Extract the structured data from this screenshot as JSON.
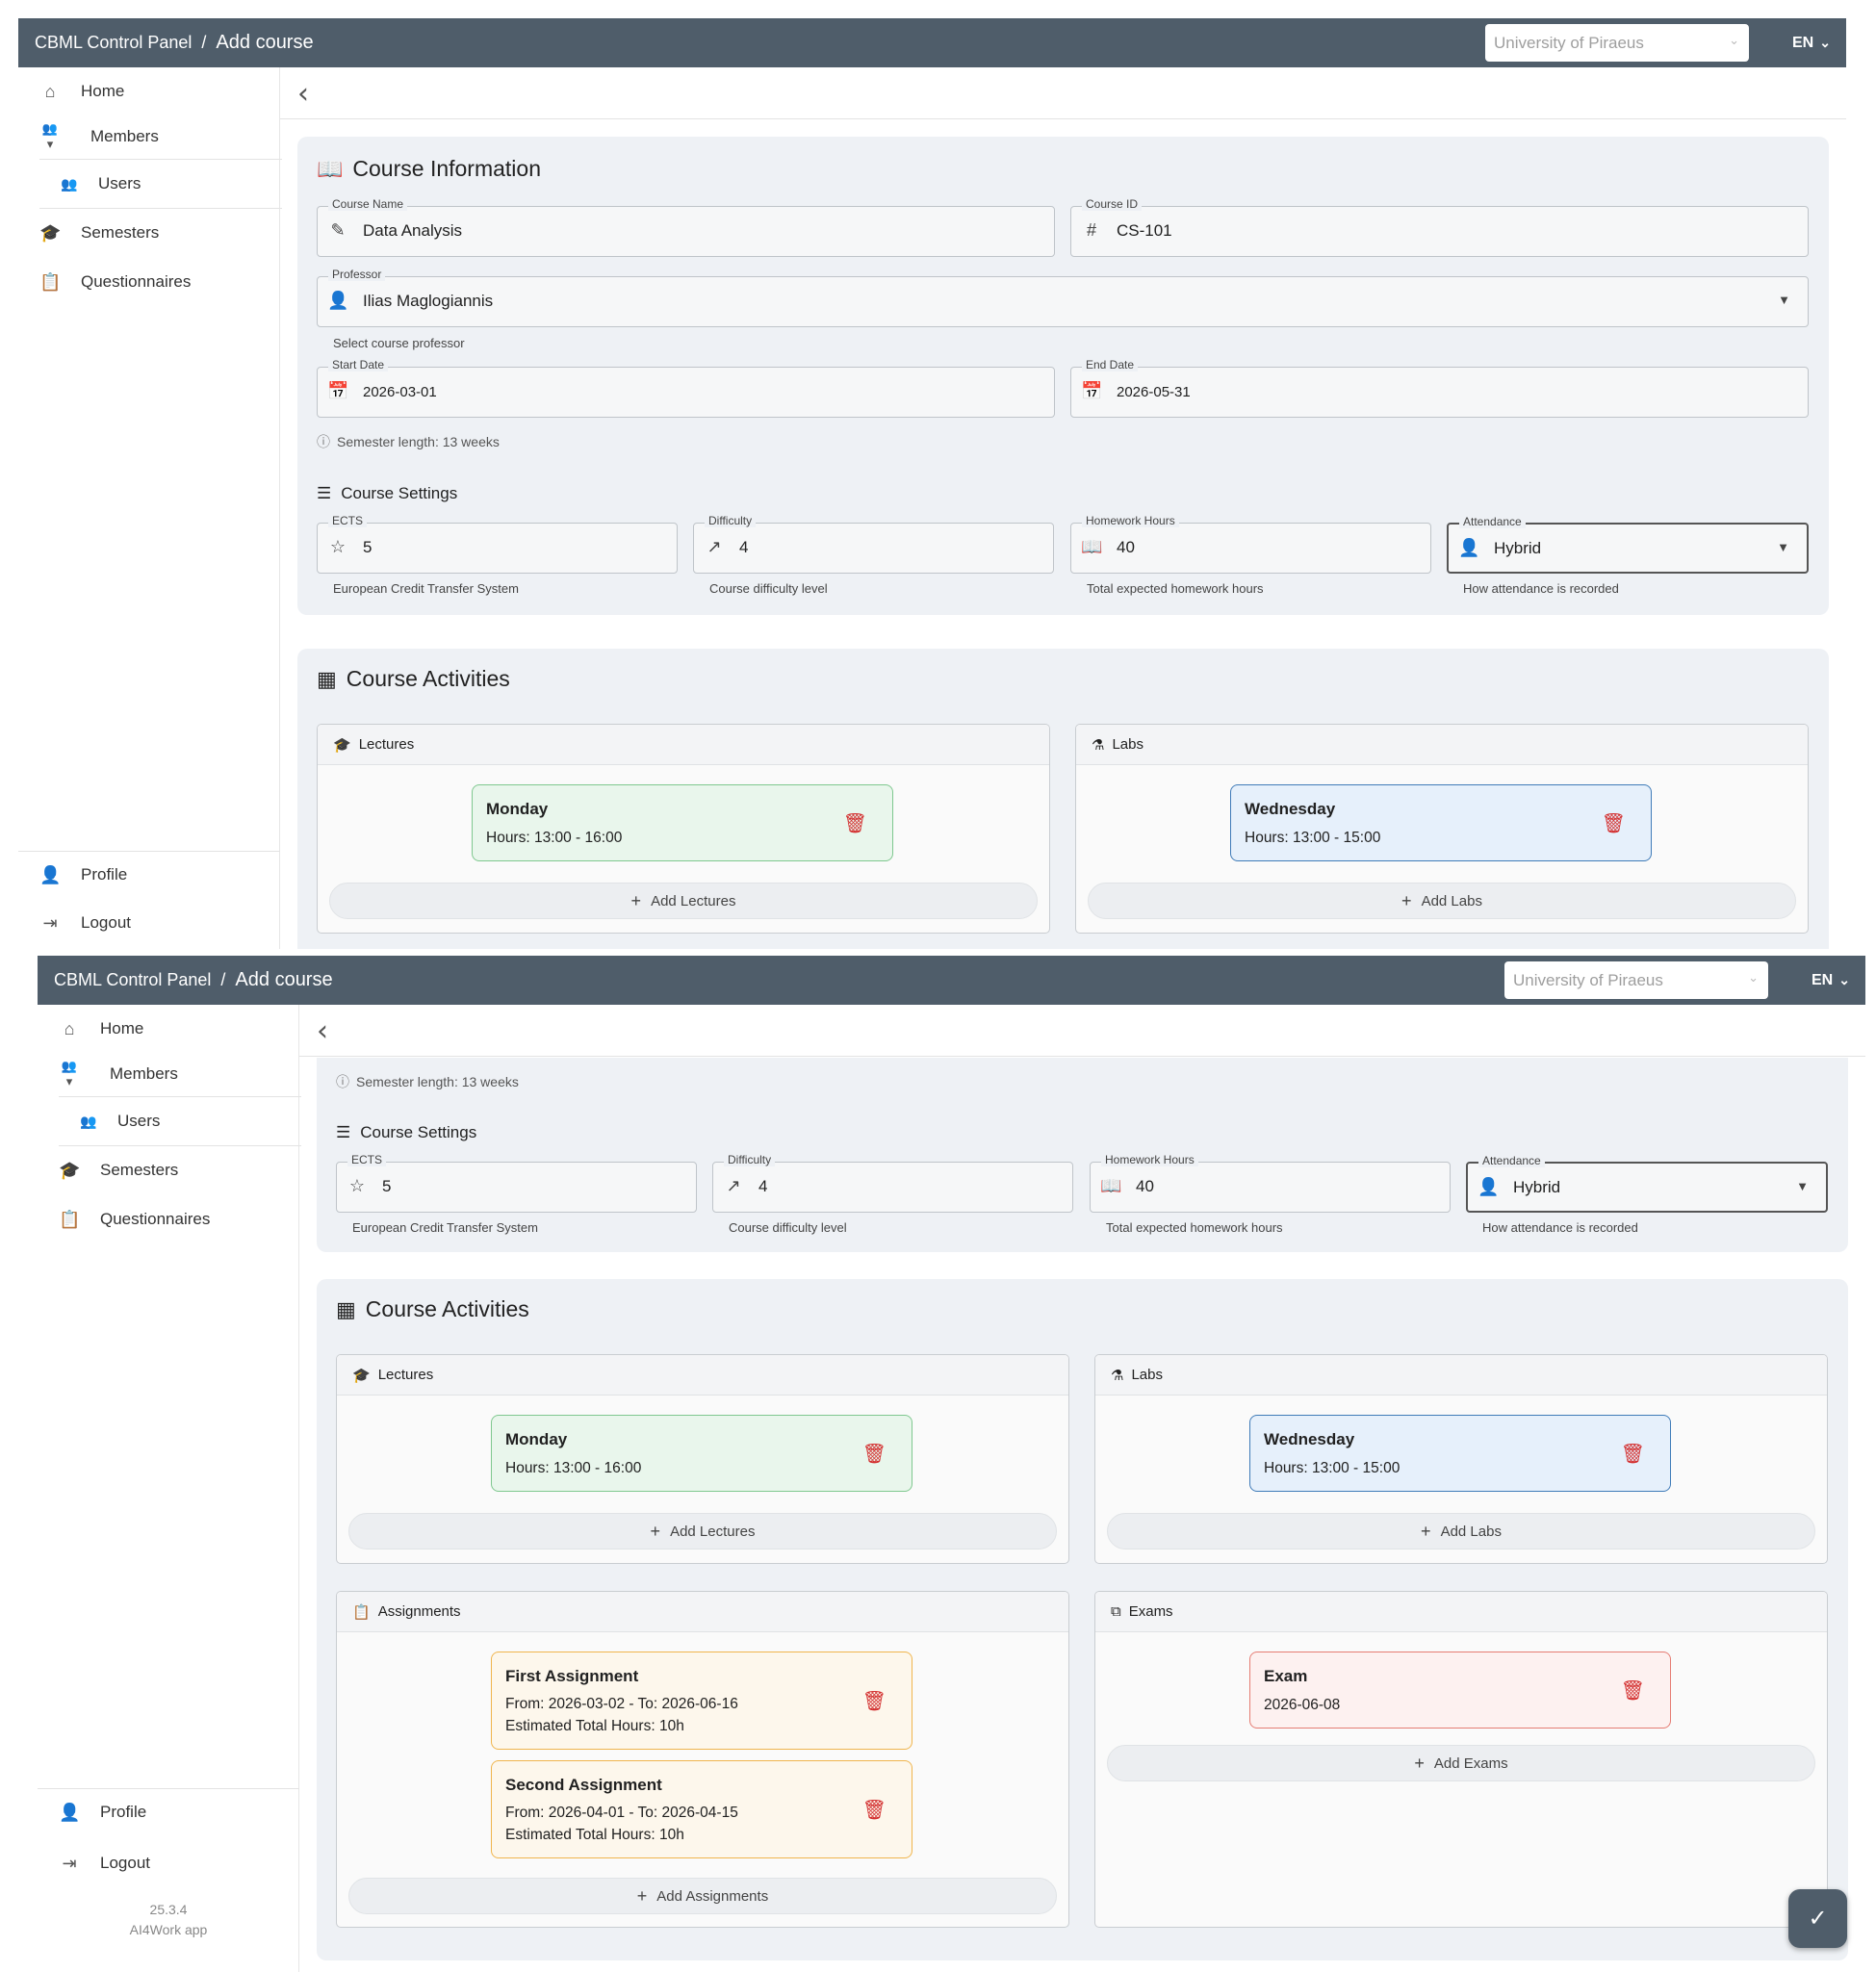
{
  "app": {
    "breadcrumb_root": "CBML Control Panel",
    "breadcrumb_sep": "/",
    "breadcrumb_current": "Add course",
    "university_placeholder": "University of Piraeus",
    "language": "EN"
  },
  "sidebar": {
    "home": "Home",
    "members": "Members",
    "users": "Users",
    "semesters": "Semesters",
    "questionnaires": "Questionnaires",
    "profile": "Profile",
    "logout": "Logout",
    "version": "25.3.4",
    "app_name": "AI4Work app"
  },
  "course_info": {
    "title": "Course Information",
    "course_name_label": "Course Name",
    "course_name": "Data Analysis",
    "course_id_label": "Course ID",
    "course_id": "CS-101",
    "professor_label": "Professor",
    "professor": "Ilias Maglogiannis",
    "professor_hint": "Select course professor",
    "start_date_label": "Start Date",
    "start_date": "2026-03-01",
    "end_date_label": "End Date",
    "end_date": "2026-05-31",
    "semester_length": "Semester length: 13 weeks"
  },
  "settings": {
    "title": "Course Settings",
    "ects_label": "ECTS",
    "ects": "5",
    "ects_hint": "European Credit Transfer System",
    "difficulty_label": "Difficulty",
    "difficulty": "4",
    "difficulty_hint": "Course difficulty level",
    "homework_label": "Homework Hours",
    "homework": "40",
    "homework_hint": "Total expected homework hours",
    "attendance_label": "Attendance",
    "attendance": "Hybrid",
    "attendance_hint": "How attendance is recorded"
  },
  "activities": {
    "title": "Course Activities",
    "lectures": {
      "title": "Lectures",
      "items": [
        {
          "day": "Monday",
          "hours": "Hours: 13:00 - 16:00"
        }
      ],
      "add": "Add Lectures"
    },
    "labs": {
      "title": "Labs",
      "items": [
        {
          "day": "Wednesday",
          "hours": "Hours: 13:00 - 15:00"
        }
      ],
      "add": "Add Labs"
    },
    "assignments": {
      "title": "Assignments",
      "items": [
        {
          "name": "First Assignment",
          "range": "From: 2026-03-02 - To: 2026-06-16",
          "hours": "Estimated Total Hours: 10h"
        },
        {
          "name": "Second Assignment",
          "range": "From: 2026-04-01 - To: 2026-04-15",
          "hours": "Estimated Total Hours: 10h"
        }
      ],
      "add": "Add Assignments"
    },
    "exams": {
      "title": "Exams",
      "items": [
        {
          "name": "Exam",
          "date": "2026-06-08"
        }
      ],
      "add": "Add Exams"
    }
  },
  "colors": {
    "topbar": "#4f5d6a",
    "card_bg": "#eef1f5",
    "lecture_green": "#7fc88f",
    "lab_blue": "#3f7bb8",
    "assignment_orange": "#f0b54d",
    "exam_red": "#e57c73",
    "delete_red": "#d32f2f"
  },
  "icons": {
    "home": "home-icon",
    "members": "group-icon",
    "semesters": "school-icon",
    "questionnaires": "clipboard-icon",
    "profile": "person-icon",
    "logout": "logout-icon",
    "save": "check-icon"
  }
}
